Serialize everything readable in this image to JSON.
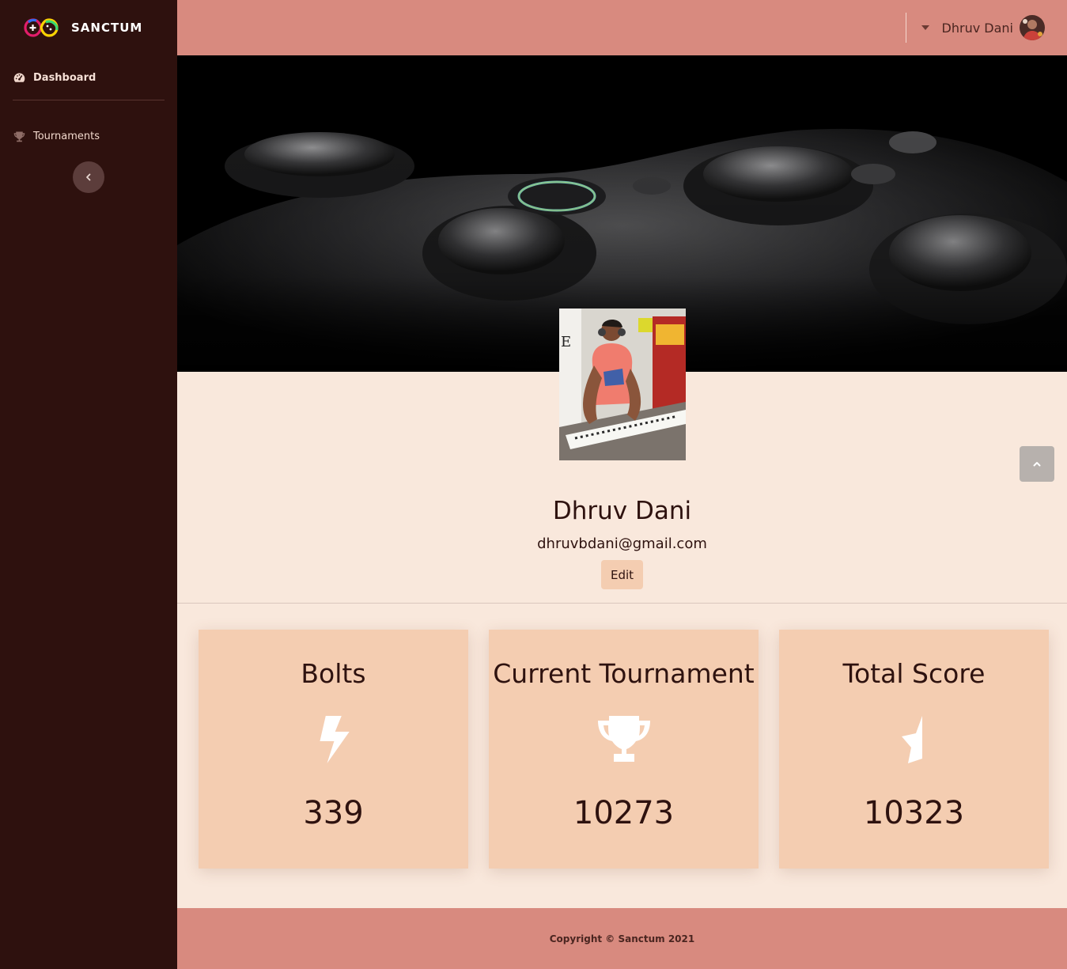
{
  "app": {
    "name": "SANCTUM"
  },
  "sidebar": {
    "items": [
      {
        "label": "Dashboard",
        "icon": "tachometer-icon",
        "active": true
      },
      {
        "label": "Tournaments",
        "icon": "trophy-icon",
        "active": false
      }
    ],
    "toggle_icon": "chevron-left-icon"
  },
  "topbar": {
    "user_name": "Dhruv Dani",
    "dropdown_icon": "caret-down-icon"
  },
  "profile": {
    "name": "Dhruv Dani",
    "email": "dhruvbdani@gmail.com",
    "edit_label": "Edit"
  },
  "stats": [
    {
      "title": "Bolts",
      "icon": "bolt-icon",
      "value": "339"
    },
    {
      "title": "Current Tournament",
      "icon": "trophy-icon",
      "value": "10273"
    },
    {
      "title": "Total Score",
      "icon": "star-half-icon",
      "value": "10323"
    }
  ],
  "footer": {
    "copyright": "Copyright © Sanctum 2021"
  },
  "colors": {
    "sidebar_bg": "#2e110e",
    "topbar_bg": "#d88a7f",
    "page_bg": "#f9e8dc",
    "card_bg": "#f4cdb1",
    "text_dark": "#2e120f"
  }
}
